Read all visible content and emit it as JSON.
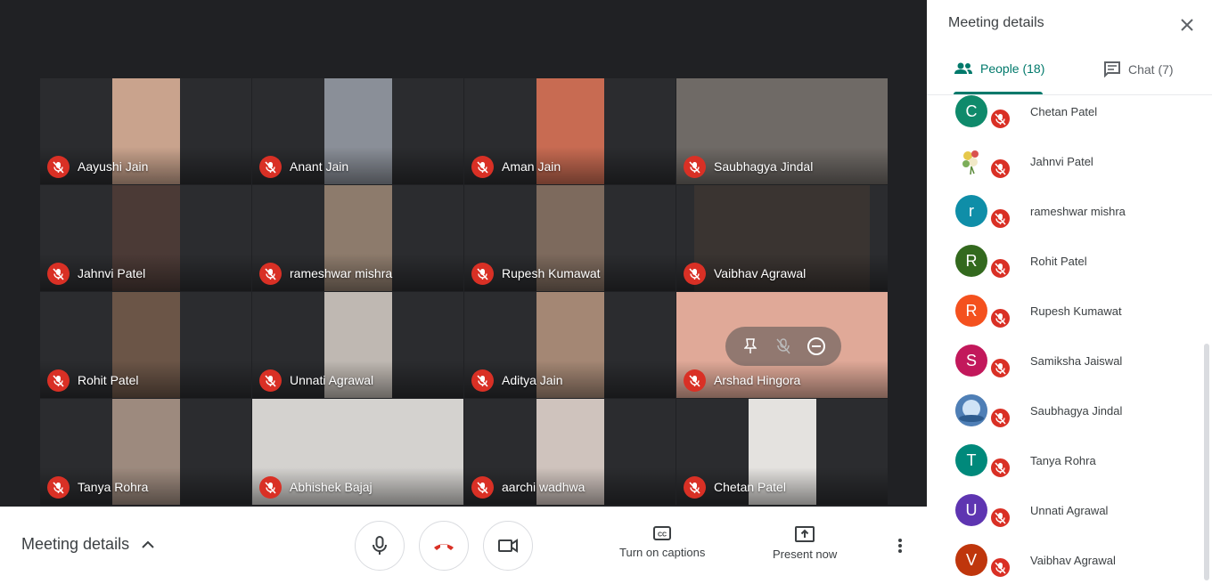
{
  "tiles": [
    {
      "name": "Aayushi Jain",
      "bg": "#c9a38d"
    },
    {
      "name": "Anant Jain",
      "bg": "#8a8f98"
    },
    {
      "name": "Aman Jain",
      "bg": "#c86b52"
    },
    {
      "name": "Saubhagya Jindal",
      "bg": "#6f6a66"
    },
    {
      "name": "Jahnvi Patel",
      "bg": "#4b3a36"
    },
    {
      "name": "rameshwar mishra",
      "bg": "#8d7b6c"
    },
    {
      "name": "Rupesh Kumawat",
      "bg": "#7d6a5d"
    },
    {
      "name": "Vaibhav Agrawal",
      "bg": "#3a3431"
    },
    {
      "name": "Rohit Patel",
      "bg": "#6b5547"
    },
    {
      "name": "Unnati Agrawal",
      "bg": "#bfb8b2"
    },
    {
      "name": "Aditya Jain",
      "bg": "#a48774"
    },
    {
      "name": "Arshad Hingora",
      "bg": "#e0a998"
    },
    {
      "name": "Tanya Rohra",
      "bg": "#9d8a7e"
    },
    {
      "name": "Abhishek Bajaj",
      "bg": "#d4d2cf"
    },
    {
      "name": "aarchi wadhwa",
      "bg": "#cfc3bd"
    },
    {
      "name": "Chetan Patel",
      "bg": "#e4e2df"
    }
  ],
  "bottom_bar": {
    "meeting_details_label": "Meeting details",
    "captions_label": "Turn on captions",
    "present_label": "Present now"
  },
  "panel": {
    "title": "Meeting details",
    "tabs": {
      "people": "People (18)",
      "chat": "Chat (7)"
    },
    "people": [
      {
        "name": "Chetan Patel",
        "initial": "C",
        "color": "#0f8a6b"
      },
      {
        "name": "Jahnvi Patel",
        "initial": "",
        "color": "#ffffff"
      },
      {
        "name": "rameshwar mishra",
        "initial": "r",
        "color": "#0f8ea8"
      },
      {
        "name": "Rohit Patel",
        "initial": "R",
        "color": "#33691e"
      },
      {
        "name": "Rupesh Kumawat",
        "initial": "R",
        "color": "#f4511e"
      },
      {
        "name": "Samiksha Jaiswal",
        "initial": "S",
        "color": "#c2185b"
      },
      {
        "name": "Saubhagya Jindal",
        "initial": "",
        "color": "#5a7fa8"
      },
      {
        "name": "Tanya Rohra",
        "initial": "T",
        "color": "#00897b"
      },
      {
        "name": "Unnati Agrawal",
        "initial": "U",
        "color": "#5e35b1"
      },
      {
        "name": "Vaibhav Agrawal",
        "initial": "V",
        "color": "#bf360c"
      }
    ]
  }
}
